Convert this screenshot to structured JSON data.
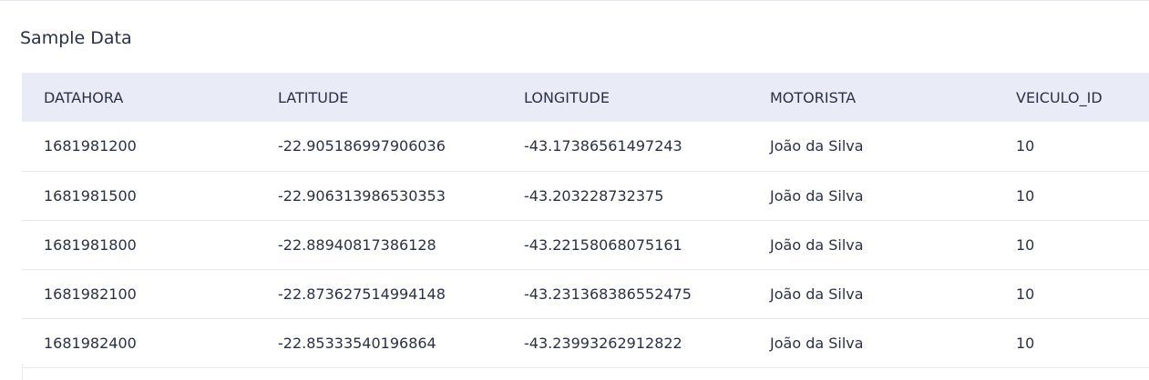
{
  "section": {
    "title": "Sample Data"
  },
  "table": {
    "columns": [
      "DATAHORA",
      "LATITUDE",
      "LONGITUDE",
      "MOTORISTA",
      "VEICULO_ID"
    ],
    "rows": [
      [
        "1681981200",
        "-22.905186997906036",
        "-43.17386561497243",
        "João da Silva",
        "10"
      ],
      [
        "1681981500",
        "-22.906313986530353",
        "-43.203228732375",
        "João da Silva",
        "10"
      ],
      [
        "1681981800",
        "-22.88940817386128",
        "-43.22158068075161",
        "João da Silva",
        "10"
      ],
      [
        "1681982100",
        "-22.873627514994148",
        "-43.231368386552475",
        "João da Silva",
        "10"
      ],
      [
        "1681982400",
        "-22.85333540196864",
        "-43.23993262912822",
        "João da Silva",
        "10"
      ]
    ]
  }
}
